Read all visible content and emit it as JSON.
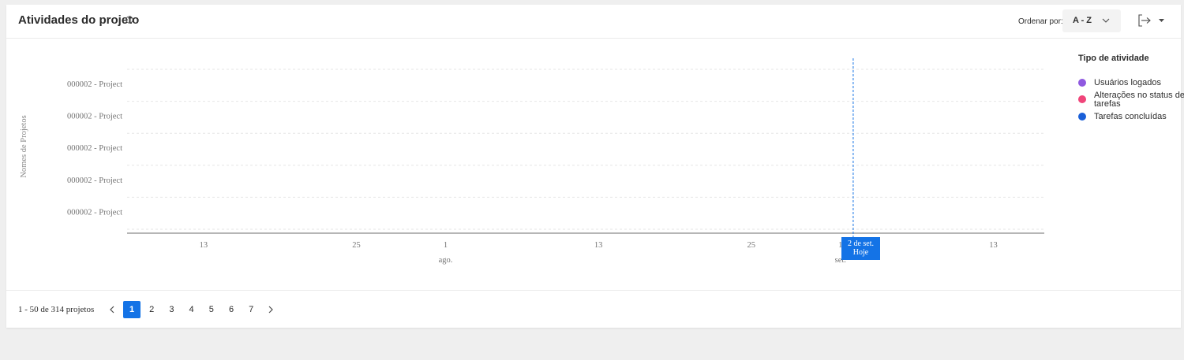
{
  "header": {
    "title": "Atividades do projeto",
    "info_icon": "info-icon",
    "sort_label": "Ordenar por:",
    "sort_value": "A - Z",
    "sort_icon": "chevron-down-icon",
    "export_icon": "export-icon",
    "export_dropdown_icon": "caret-down-icon"
  },
  "chart_data": {
    "type": "timeline",
    "ylabel": "Nomes de Projetos",
    "rows": [
      "000002 - Project",
      "000002 - Project",
      "000002 - Project",
      "000002 - Project",
      "000002 - Project"
    ],
    "x_ticks": [
      "13",
      "25",
      "1",
      "13",
      "25",
      "1",
      "13"
    ],
    "x_month_labels": [
      "ago.",
      "set."
    ],
    "x_range": [
      "2024-07-07",
      "2024-09-17"
    ],
    "today_date": "2024-09-02",
    "today_label": [
      "2 de set.",
      "Hoje"
    ],
    "grid": true,
    "legend": {
      "title": "Tipo de atividade",
      "position": "right",
      "items": [
        {
          "label": "Usuários logados",
          "color": "#8f59e0"
        },
        {
          "label": "Alterações no status de tarefas",
          "color": "#f0457a"
        },
        {
          "label": "Tarefas concluídas",
          "color": "#1a5fd8"
        }
      ]
    },
    "series": []
  },
  "footer": {
    "range_text": "1 - 50 de 314 projetos",
    "pages": [
      "1",
      "2",
      "3",
      "4",
      "5",
      "6",
      "7"
    ],
    "current_page": "1",
    "prev_icon": "chevron-left-icon",
    "next_icon": "chevron-right-icon"
  },
  "colors": {
    "accent": "#1473e6",
    "grid": "#e4e4e4",
    "axis": "#8a8a8a",
    "muted_text": "#737373"
  }
}
